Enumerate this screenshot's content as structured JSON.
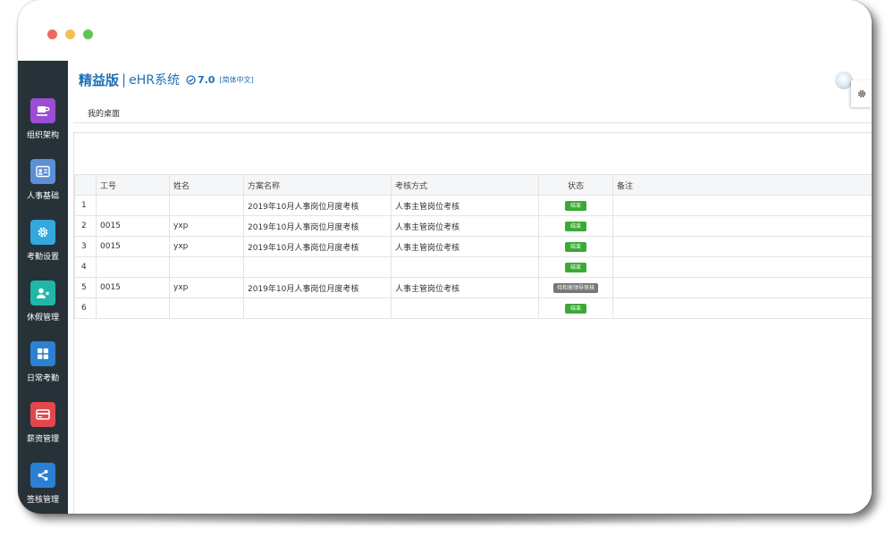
{
  "app": {
    "brand_strong": "精益版",
    "brand_sep": "|",
    "brand_system": "eHR系统",
    "version": "7.0",
    "language": "[简体中文]"
  },
  "sidebar": {
    "items": [
      {
        "label": "组织架构",
        "icon": "cup-icon",
        "color": "#9b4dd6"
      },
      {
        "label": "人事基础",
        "icon": "id-card-icon",
        "color": "#5b8fd6"
      },
      {
        "label": "考勤设置",
        "icon": "gear-icon",
        "color": "#33a7de"
      },
      {
        "label": "休假管理",
        "icon": "user-icon",
        "color": "#1fb7a8"
      },
      {
        "label": "日常考勤",
        "icon": "grid-icon",
        "color": "#2c80d3"
      },
      {
        "label": "薪资管理",
        "icon": "card-icon",
        "color": "#e0484c"
      },
      {
        "label": "签核管理",
        "icon": "share-icon",
        "color": "#2c80d3"
      }
    ]
  },
  "tabs": {
    "home": "我的桌面"
  },
  "table": {
    "headers": [
      "",
      "工号",
      "姓名",
      "方案名称",
      "考核方式",
      "状态",
      "备注"
    ],
    "rows": [
      {
        "num": "1",
        "id": "",
        "name": "",
        "plan": "2019年10月人事岗位月度考核",
        "method": "人事主管岗位考核",
        "status": "结束",
        "status_type": "ended",
        "remark": ""
      },
      {
        "num": "2",
        "id": "0015",
        "name": "yxp",
        "plan": "2019年10月人事岗位月度考核",
        "method": "人事主管岗位考核",
        "status": "结束",
        "status_type": "ended",
        "remark": ""
      },
      {
        "num": "3",
        "id": "0015",
        "name": "yxp",
        "plan": "2019年10月人事岗位月度考核",
        "method": "人事主管岗位考核",
        "status": "结束",
        "status_type": "ended",
        "remark": ""
      },
      {
        "num": "4",
        "id": "",
        "name": "",
        "plan": "",
        "method": "",
        "status": "结束",
        "status_type": "ended",
        "remark": ""
      },
      {
        "num": "5",
        "id": "0015",
        "name": "yxp",
        "plan": "2019年10月人事岗位月度考核",
        "method": "人事主管岗位考核",
        "status": "待和按领导审核",
        "status_type": "pending",
        "remark": ""
      },
      {
        "num": "6",
        "id": "",
        "name": "",
        "plan": "",
        "method": "",
        "status": "结束",
        "status_type": "ended",
        "remark": ""
      }
    ]
  },
  "colors": {
    "brand": "#1e6fb5",
    "sidebar_bg": "#263238",
    "status_ended": "#3aaa35",
    "status_pending": "#777777"
  }
}
